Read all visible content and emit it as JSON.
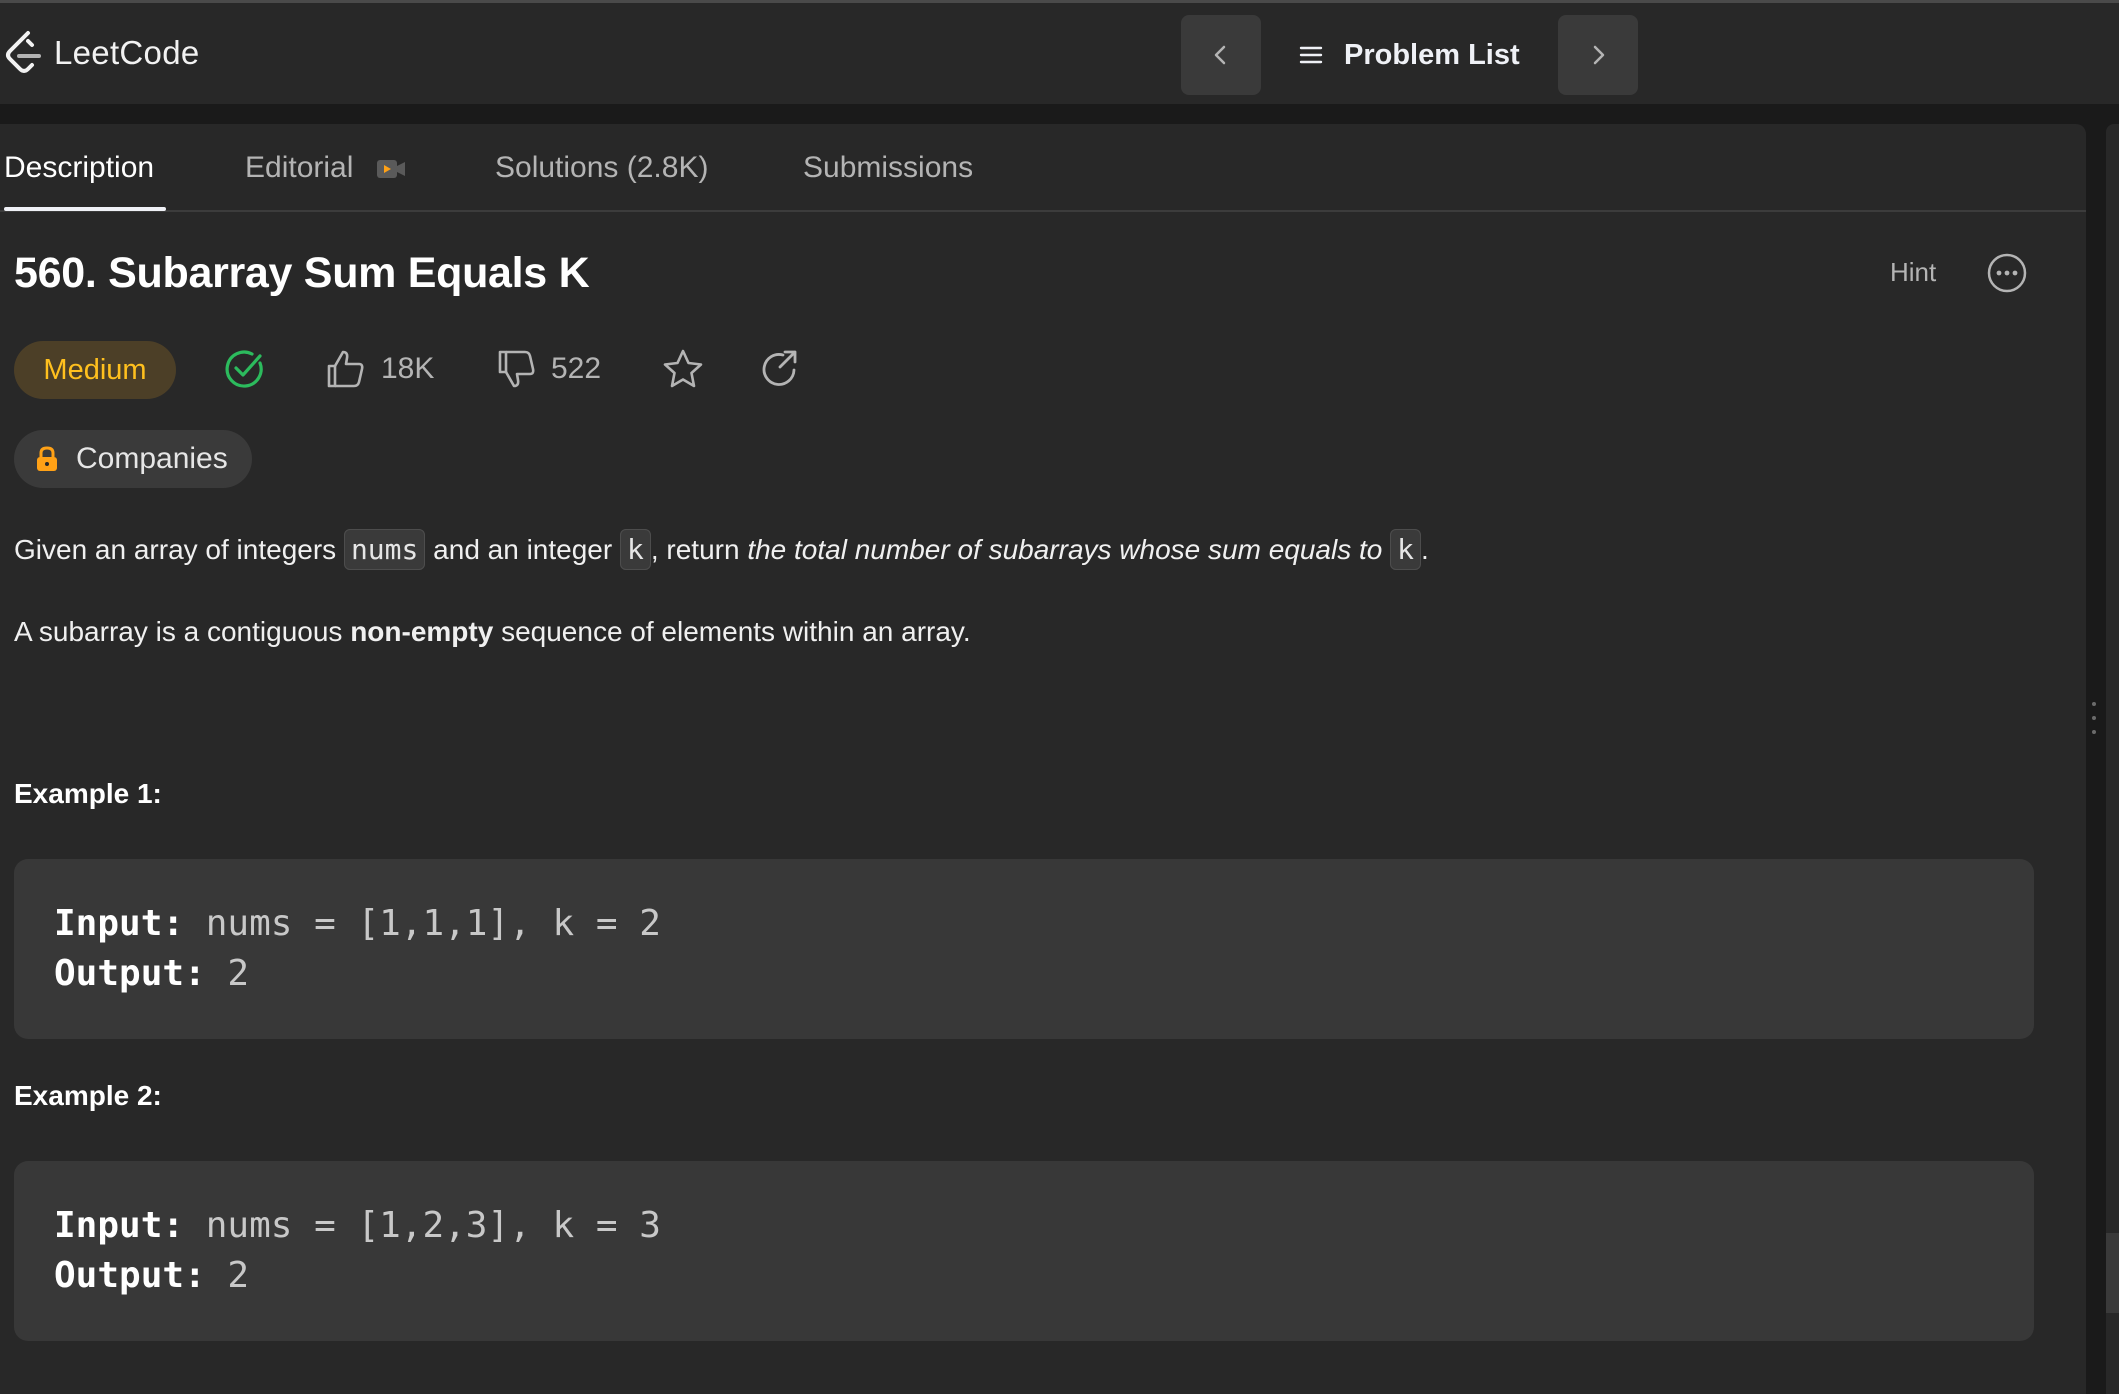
{
  "app": {
    "name": "LeetCode"
  },
  "nav": {
    "problem_list": "Problem List"
  },
  "tabs": [
    {
      "label": "Description",
      "active": true
    },
    {
      "label": "Editorial",
      "active": false
    },
    {
      "label": "Solutions (2.8K)",
      "active": false
    },
    {
      "label": "Submissions",
      "active": false
    }
  ],
  "problem": {
    "title": "560. Subarray Sum Equals K",
    "hint": "Hint",
    "difficulty": "Medium",
    "likes": "18K",
    "dislikes": "522",
    "companies": "Companies",
    "desc1": {
      "p1": "Given an array of integers ",
      "code1": "nums",
      "p2": " and an integer ",
      "code2": "k",
      "p3": ", return ",
      "em": "the total number of subarrays whose sum equals to",
      "p4": " ",
      "code3": "k",
      "p5": "."
    },
    "desc2": {
      "p1": "A subarray is a contiguous ",
      "bold": "non-empty",
      "p2": " sequence of elements within an array."
    },
    "examples": [
      {
        "title": "Example 1:",
        "input_label": "Input:",
        "input": " nums = [1,1,1], k = 2",
        "output_label": "Output:",
        "output": " 2"
      },
      {
        "title": "Example 2:",
        "input_label": "Input:",
        "input": " nums = [1,2,3], k = 3",
        "output_label": "Output:",
        "output": " 2"
      }
    ]
  },
  "colors": {
    "background": "#1a1a1a",
    "panel": "#282828",
    "medium": "#ffc01e",
    "solved": "#2cbb5d",
    "lock": "#ffa116"
  },
  "icons": [
    "leetcode-logo-icon",
    "chevron-left-icon",
    "list-icon",
    "chevron-right-icon",
    "video-icon",
    "more-icon",
    "check-circle-icon",
    "thumbs-up-icon",
    "thumbs-down-icon",
    "star-icon",
    "share-icon",
    "lock-icon"
  ]
}
